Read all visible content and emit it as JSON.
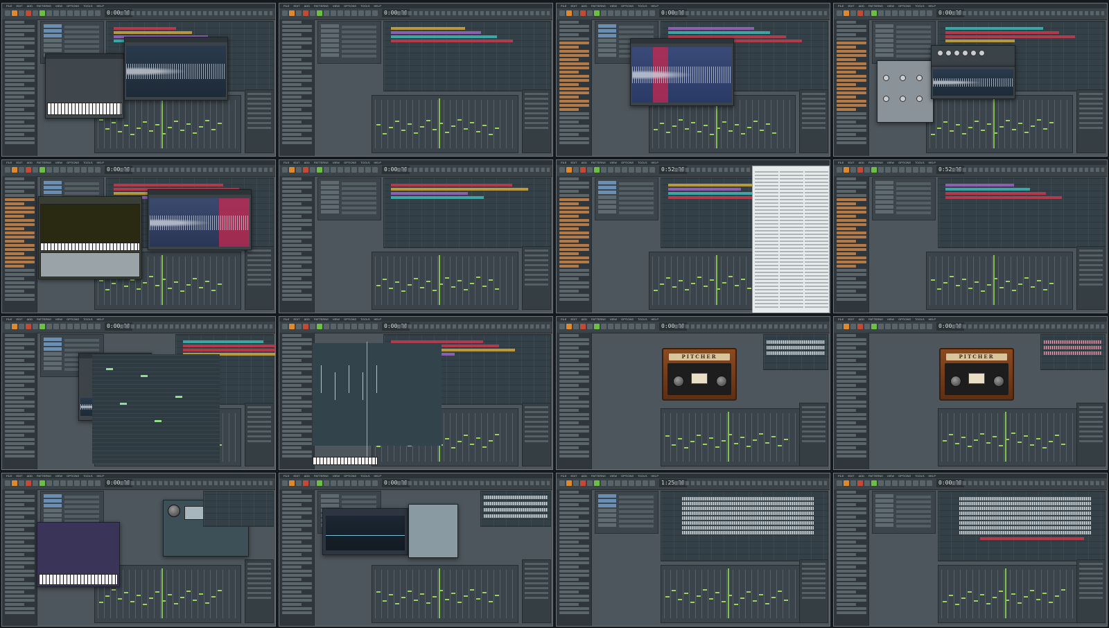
{
  "menu": [
    "FILE",
    "EDIT",
    "ADD",
    "PATTERNS",
    "VIEW",
    "OPTIONS",
    "TOOLS",
    "HELP"
  ],
  "tiles": [
    {
      "time": "0:00:00",
      "plugin": "sampler"
    },
    {
      "time": "0:00:00",
      "plugin": "none"
    },
    {
      "time": "0:00:00",
      "plugin": "edison"
    },
    {
      "time": "0:00:00",
      "plugin": "effect"
    },
    {
      "time": "0:00:00",
      "plugin": "synth"
    },
    {
      "time": "0:00:00",
      "plugin": "none"
    },
    {
      "time": "0:52:00",
      "plugin": "menu"
    },
    {
      "time": "0:52:00",
      "plugin": "none"
    },
    {
      "time": "0:00:00",
      "plugin": "pianoroll"
    },
    {
      "time": "0:00:00",
      "plugin": "automation"
    },
    {
      "time": "0:00:00",
      "plugin": "pitcher"
    },
    {
      "time": "0:00:00",
      "plugin": "pitcher"
    },
    {
      "time": "0:00:00",
      "plugin": "vst"
    },
    {
      "time": "0:00:00",
      "plugin": "eq"
    },
    {
      "time": "1:25:00",
      "plugin": "playlist"
    },
    {
      "time": "0:00:00",
      "plugin": "playlist"
    }
  ],
  "pitcher_label": "PITCHER",
  "colors": {
    "accent": "#e0882c",
    "fader": "#9bd35c",
    "clip_red": "#b33a4b"
  }
}
